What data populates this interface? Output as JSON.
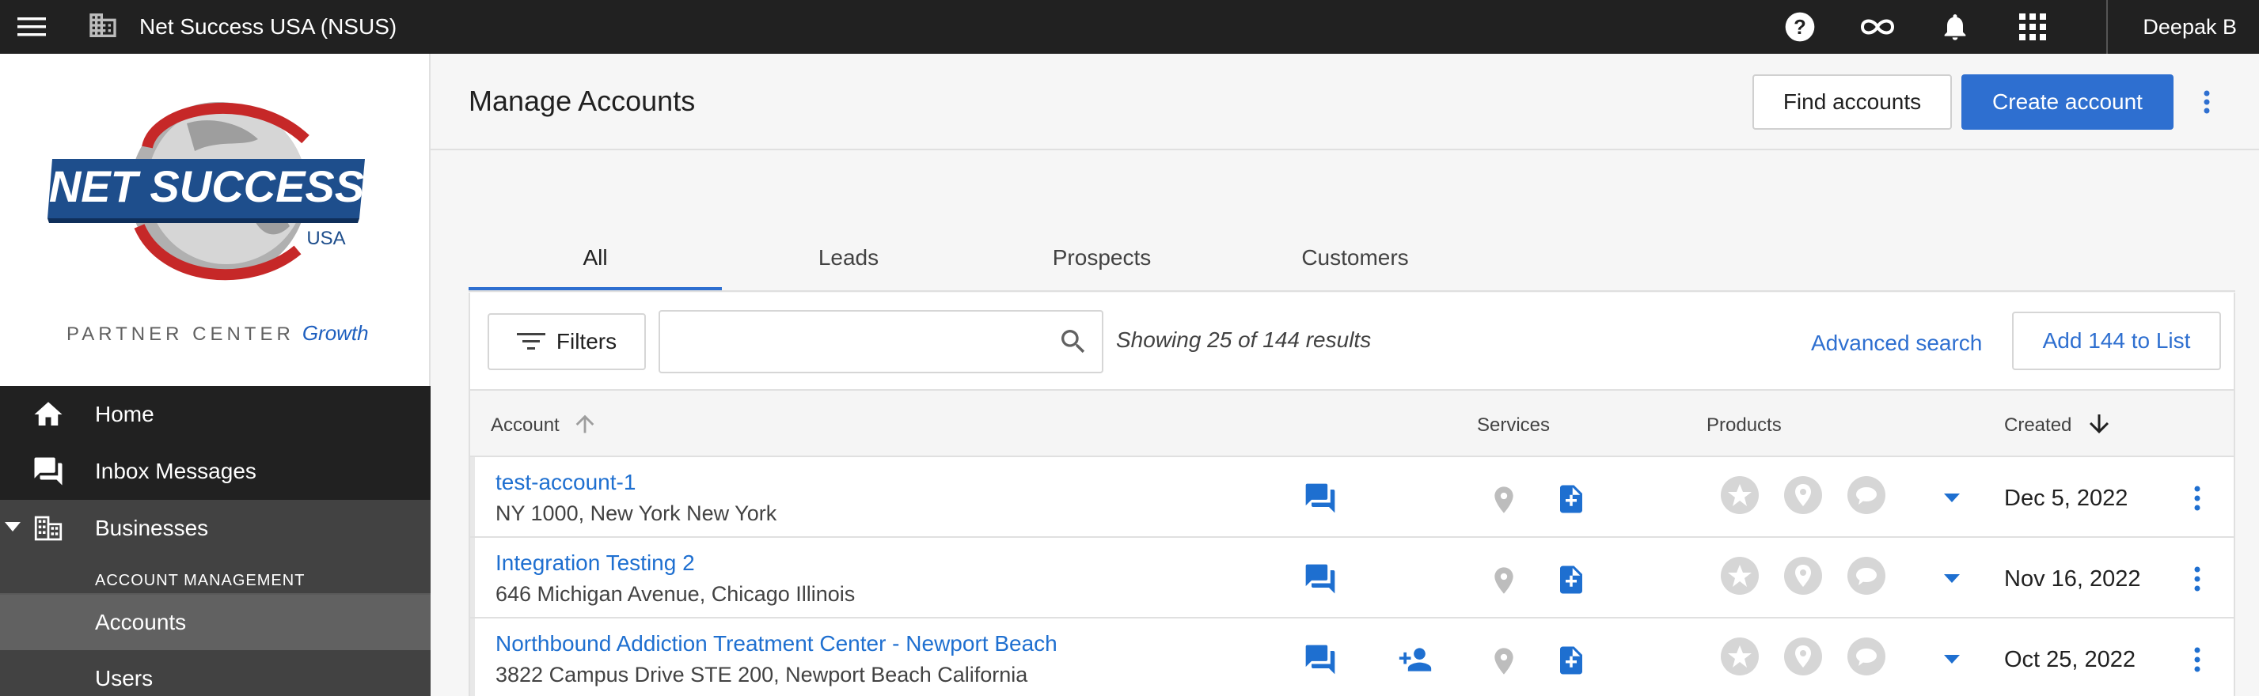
{
  "topbar": {
    "org_name": "Net Success USA (NSUS)",
    "user_name": "Deepak B",
    "icons": [
      "help-icon",
      "infinity-icon",
      "bell-icon",
      "apps-grid-icon"
    ]
  },
  "sidebar": {
    "logo_text": "NET SUCCESS",
    "logo_sub": "USA",
    "partner_center": "PARTNER CENTER",
    "growth": "Growth",
    "items": [
      {
        "label": "Home",
        "icon": "home-icon"
      },
      {
        "label": "Inbox Messages",
        "icon": "inbox-icon"
      },
      {
        "label": "Businesses",
        "icon": "business-icon"
      }
    ],
    "section_title": "ACCOUNT MANAGEMENT",
    "subitems": [
      {
        "label": "Accounts"
      },
      {
        "label": "Users"
      }
    ]
  },
  "page": {
    "title": "Manage Accounts",
    "find_accounts": "Find accounts",
    "create_account": "Create account"
  },
  "tabs": [
    {
      "label": "All",
      "active": true
    },
    {
      "label": "Leads"
    },
    {
      "label": "Prospects"
    },
    {
      "label": "Customers"
    }
  ],
  "toolbar": {
    "filters": "Filters",
    "search_placeholder": "",
    "results_text": "Showing 25 of 144 results",
    "advanced_search": "Advanced search",
    "add_to_list": "Add 144 to List"
  },
  "table": {
    "columns": {
      "account": "Account",
      "services": "Services",
      "products": "Products",
      "created": "Created"
    },
    "rows": [
      {
        "name": "test-account-1",
        "address": "NY 1000, New York New York",
        "created": "Dec 5, 2022",
        "has_user_icon": false
      },
      {
        "name": "Integration Testing 2",
        "address": "646 Michigan Avenue, Chicago Illinois",
        "created": "Nov 16, 2022",
        "has_user_icon": false
      },
      {
        "name": "Northbound Addiction Treatment Center - Newport Beach",
        "address": "3822 Campus Drive STE 200, Newport Beach California",
        "created": "Oct 25, 2022",
        "has_user_icon": true
      }
    ]
  },
  "colors": {
    "topbar": "#212121",
    "accent": "#2e6fd0",
    "link": "#1e6fd0",
    "nav_bg": "#212121",
    "nav_active": "#616161"
  }
}
